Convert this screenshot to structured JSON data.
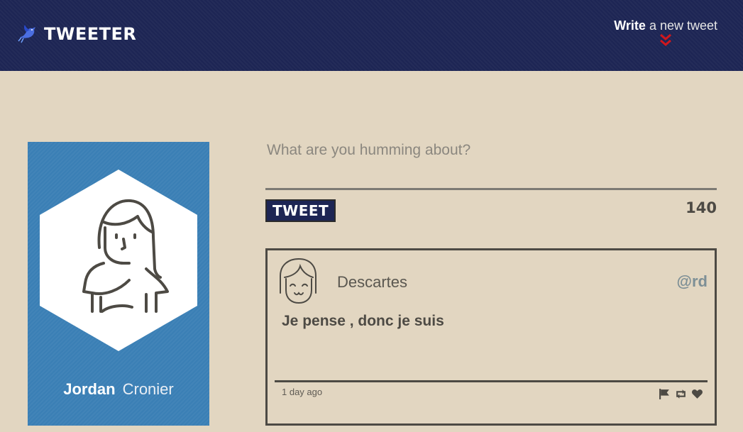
{
  "header": {
    "brand": "TWEETER",
    "compose_bold": "Write",
    "compose_rest": " a new tweet"
  },
  "icons": {
    "logo": "bird-icon",
    "compose_toggle": "double-chevron-down-icon",
    "avatar": "user-avatar-icon",
    "actions": [
      "flag-icon",
      "retweet-icon",
      "heart-icon"
    ]
  },
  "colors": {
    "header_bg": "#1d2554",
    "page_bg": "#e2d6c1",
    "profile_bg": "#3a7fb5",
    "chevron": "#d0171d",
    "handle": "#7d8f96"
  },
  "profile": {
    "first_name": "Jordan",
    "last_name": "Cronier"
  },
  "composer": {
    "placeholder": "What are you humming about?",
    "button_label": "TWEET",
    "counter": "140"
  },
  "tweet": {
    "author": "Descartes",
    "handle": "@rd",
    "body": "Je pense , donc je suis",
    "time": "1 day ago"
  }
}
